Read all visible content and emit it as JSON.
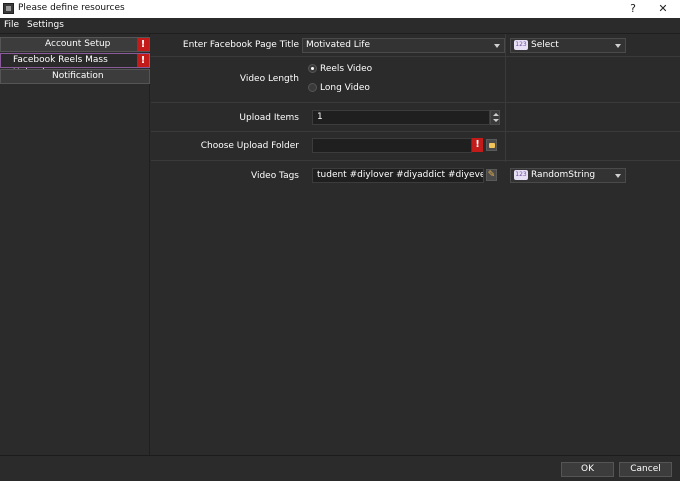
{
  "window": {
    "title": "Please define resources",
    "help_glyph": "?",
    "close_glyph": "✕"
  },
  "menu": {
    "file": "File",
    "settings": "Settings"
  },
  "sidebar": {
    "items": [
      {
        "label": "Account Setup",
        "error": "!"
      },
      {
        "label": "Facebook Reels Mass Uploader",
        "error": "!"
      },
      {
        "label": "Notification"
      }
    ]
  },
  "form": {
    "page_title": {
      "label": "Enter Facebook Page Title",
      "value": "Motivated Life",
      "type_badge": "123",
      "type_value": "Select"
    },
    "video_length": {
      "label": "Video Length",
      "options": [
        "Reels Video",
        "Long Video"
      ],
      "selected": "Reels Video"
    },
    "upload_items": {
      "label": "Upload Items",
      "value": "1"
    },
    "upload_folder": {
      "label": "Choose Upload Folder",
      "value": "",
      "error": "!"
    },
    "video_tags": {
      "label": "Video Tags",
      "value": "tudent #diylover #diyaddict #diyeverything}",
      "type_badge": "123",
      "type_value": "RandomString"
    }
  },
  "buttons": {
    "ok": "OK",
    "cancel": "Cancel"
  },
  "colors": {
    "background": "#2b2b2b",
    "error": "#c31a1a",
    "active_border": "#8a5a9a",
    "type_badge_text": "#6b4e9c",
    "folder_icon": "#f2c35a"
  }
}
